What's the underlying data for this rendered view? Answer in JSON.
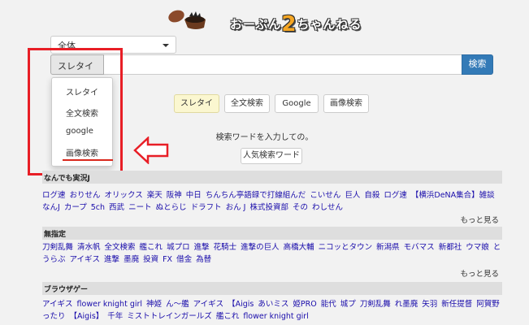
{
  "logo": {
    "text_a": "おーぷん",
    "text_b": "2",
    "text_c": "ちゃんねる"
  },
  "category_select": {
    "value": "全体"
  },
  "search": {
    "mode_label": "スレタイ",
    "button_label": "検索",
    "placeholder": ""
  },
  "mode_dropdown": {
    "items": [
      "スレタイ",
      "全文検索",
      "google",
      "画像検索"
    ]
  },
  "tabs": [
    {
      "label": "スレタイ",
      "active": true
    },
    {
      "label": "全文検索",
      "active": false
    },
    {
      "label": "Google",
      "active": false
    },
    {
      "label": "画像検索",
      "active": false
    }
  ],
  "hint_text": "検索ワードを入力しての。",
  "popular_button": "人気検索ワード",
  "sections": [
    {
      "title": "なんでも実況J",
      "line1": [
        "ログ速",
        "おりせん",
        "オリックス",
        "楽天",
        "阪神",
        "中日",
        "ちんちん亭語録で打線組んだ",
        "こいせん",
        "巨人",
        "自殺",
        "ログ速",
        "【横浜DeNA集合】雑談"
      ],
      "line2": [
        "なんJ",
        "カープ",
        "5ch",
        "西武",
        "ニート",
        "ぬとらじ",
        "ドラフト",
        "おん J",
        "株式投資部",
        "その",
        "わしせん"
      ],
      "more": "もっと見る"
    },
    {
      "title": "無指定",
      "line1": [
        "刀剣乱舞",
        "清水帆",
        "全文検索",
        "艦これ",
        "城プロ",
        "進撃",
        "花騎士",
        "進撃の巨人",
        "高橋大輔",
        "ニコッとタウン",
        "新潟県",
        "モバマス",
        "新都社",
        "ウマ娘",
        "と"
      ],
      "line2": [
        "うらぶ",
        "アイギス",
        "進撃",
        "墨廃",
        "投資",
        "FX",
        "借金",
        "為替"
      ],
      "more": "もっと見る"
    },
    {
      "title": "ブラウザゲー",
      "line1": [
        "アイギス",
        "flower knight girl",
        "神姫",
        "ん〜艦",
        "アイギス",
        "【Aigis",
        "あいミス",
        "姫PRO",
        "能代",
        "城プ",
        "刀剣乱舞",
        "れ墨廃",
        "矢羽",
        "新任提督",
        "阿賀野",
        "ま"
      ],
      "line2": [
        "ったり",
        "【Aigis】",
        "千年",
        "ミストトレインガールズ",
        "艦これ",
        "flower knight girl"
      ],
      "more": ""
    }
  ],
  "colors": {
    "annotation_red": "#e81e26",
    "primary_blue": "#337ab7",
    "link_blue": "#1a0dab"
  }
}
